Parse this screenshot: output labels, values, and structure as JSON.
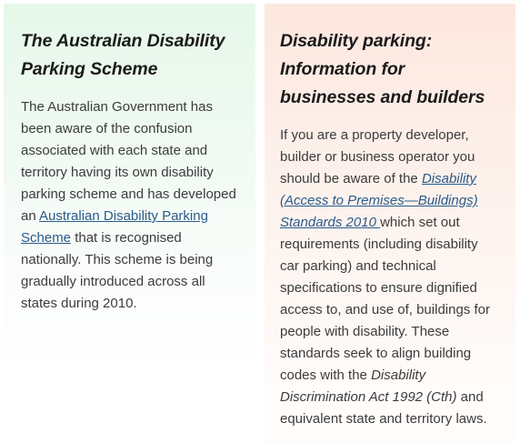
{
  "left_card": {
    "heading": "The Australian Disability Parking Scheme",
    "text_1": "The Australian Government has been aware of the confusion associated with each state and territory having its own disability parking scheme and has developed an ",
    "link": "Australian Disability Parking Scheme",
    "text_2": " that is recognised nationally. This scheme is being gradually introduced across all states during 2010."
  },
  "right_card": {
    "heading": "Disability parking: Information for businesses and builders",
    "text_1": "If you are a property developer, builder or business operator you should be aware of the ",
    "link": "Disability (Access to Premises—Buildings) Standards 2010 ",
    "text_2": "which set out requirements (including disability car parking) and technical specifications to ensure dignified access to, and use of, buildings for people with disability. These standards seek to align building codes with the ",
    "act_title": "Disability Discrimination Act 1992 (Cth)",
    "text_3": " and equivalent state and territory laws."
  },
  "colors": {
    "left_card_bg": "#e6f8ea",
    "right_card_bg": "#fde7df",
    "link": "#2a5b8a",
    "heading": "#1a1a1a",
    "body_text": "#3c3c3c"
  }
}
